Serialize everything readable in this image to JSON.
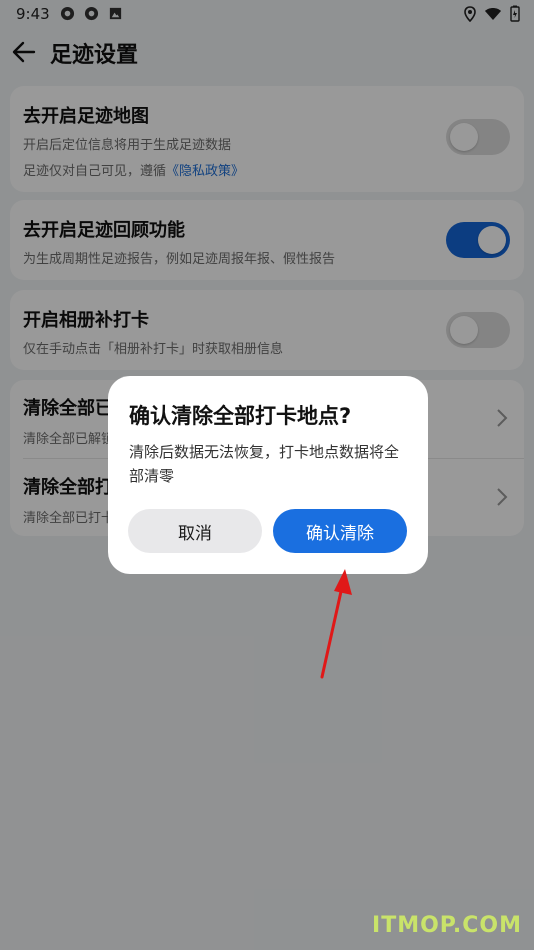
{
  "status_bar": {
    "time": "9:43"
  },
  "app_bar": {
    "title": "足迹设置"
  },
  "settings": [
    {
      "title": "去开启足迹地图",
      "desc1": "开启后定位信息将用于生成足迹数据",
      "desc2_prefix": "足迹仅对自己可见，遵循",
      "desc2_link": "《隐私政策》",
      "toggle_on": false
    },
    {
      "title": "去开启足迹回顾功能",
      "desc1": "为生成周期性足迹报告，例如足迹周报年报、假性报告",
      "toggle_on": true
    },
    {
      "title": "开启相册补打卡",
      "desc1": "仅在手动点击「相册补打卡」时获取相册信息",
      "toggle_on": false
    }
  ],
  "clear_rows": [
    {
      "title": "清除全部已",
      "desc": "清除全部已解锁"
    },
    {
      "title": "清除全部打",
      "desc": "清除全部已打卡"
    }
  ],
  "dialog": {
    "title": "确认清除全部打卡地点?",
    "message": "清除后数据无法恢复，打卡地点数据将全部清零",
    "cancel_label": "取消",
    "confirm_label": "确认清除"
  },
  "watermark": "ITMOP.COM",
  "colors": {
    "accent": "#1a6fe0",
    "annotation_arrow": "#e01818",
    "watermark": "#c9e36a"
  }
}
